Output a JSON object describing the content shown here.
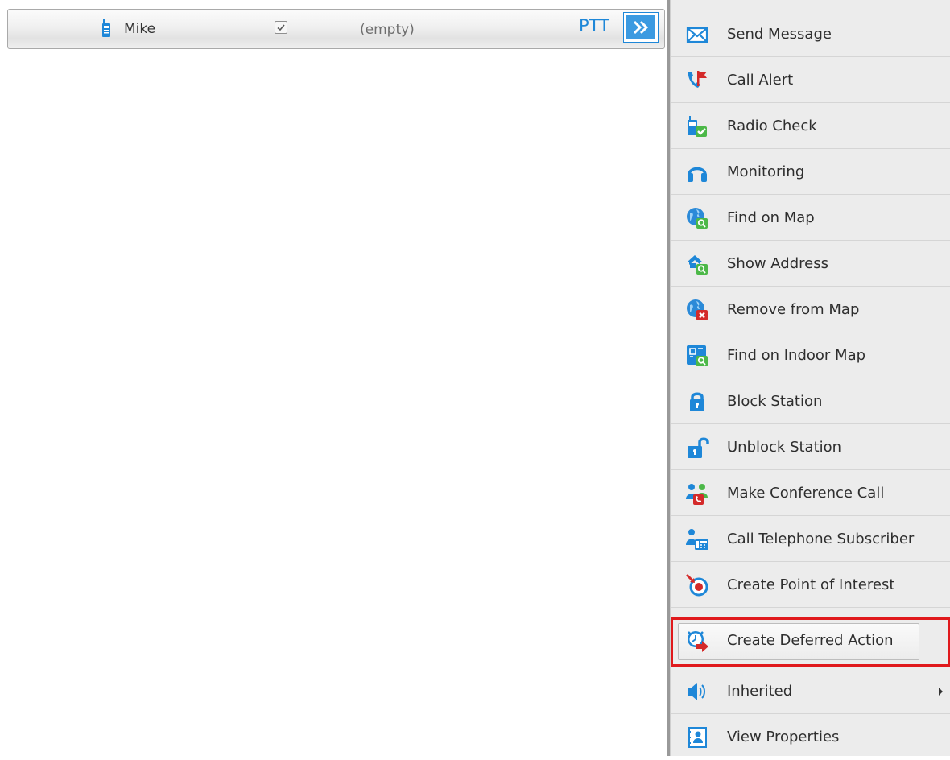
{
  "radio": {
    "name": "Mike",
    "status": "(empty)",
    "ptt_label": "PTT",
    "checked": true,
    "icon": "radio-device-icon",
    "more_icon": "double-chevron-right-icon"
  },
  "menu": {
    "items": [
      {
        "label": "Send Message",
        "icon": "envelope-icon"
      },
      {
        "label": "Call Alert",
        "icon": "phone-alert-icon"
      },
      {
        "label": "Radio Check",
        "icon": "radio-check-icon"
      },
      {
        "label": "Monitoring",
        "icon": "headphones-icon"
      },
      {
        "label": "Find on Map",
        "icon": "globe-search-icon"
      },
      {
        "label": "Show Address",
        "icon": "house-search-icon"
      },
      {
        "label": "Remove from Map",
        "icon": "globe-remove-icon"
      },
      {
        "label": "Find on Indoor Map",
        "icon": "floorplan-search-icon"
      },
      {
        "label": "Block Station",
        "icon": "lock-closed-icon"
      },
      {
        "label": "Unblock Station",
        "icon": "lock-open-icon"
      },
      {
        "label": "Make Conference Call",
        "icon": "conference-call-icon"
      },
      {
        "label": "Call Telephone Subscriber",
        "icon": "telephone-subscriber-icon"
      },
      {
        "label": "Create Point of Interest",
        "icon": "point-of-interest-icon"
      },
      {
        "label": "Create Deferred Action",
        "icon": "deferred-action-icon",
        "highlighted": true
      },
      {
        "label": "Inherited",
        "icon": "speaker-icon",
        "has_submenu": true
      },
      {
        "label": "View Properties",
        "icon": "contact-card-icon"
      }
    ]
  },
  "colors": {
    "accent": "#1e87d8",
    "highlight_border": "#e0191c",
    "menu_background": "#ececec"
  }
}
